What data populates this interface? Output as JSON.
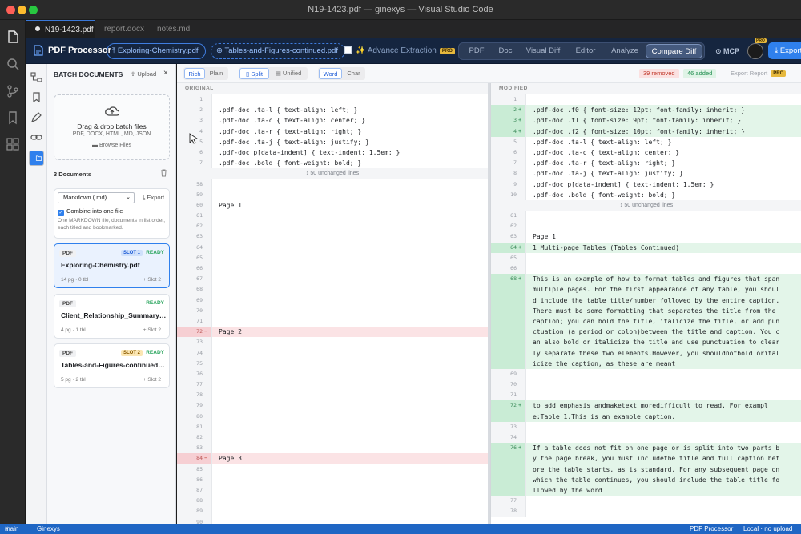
{
  "window": {
    "title": "N19-1423.pdf — ginexys — Visual Studio Code"
  },
  "tabs": [
    {
      "label": "N19-1423.pdf",
      "active": true
    },
    {
      "label": "report.docx",
      "active": false
    },
    {
      "label": "notes.md",
      "active": false
    }
  ],
  "toolbar": {
    "brand": "PDF Processor",
    "file_a": "Exploring-Chemistry.pdf",
    "file_b": "Tables-and-Figures-continued.pdf",
    "advance_extraction": "Advance Extraction",
    "pro_badge": "PRO",
    "modes": [
      "PDF",
      "Doc",
      "Visual Diff",
      "Editor",
      "Analyze",
      "Compare Diff"
    ],
    "active_mode": "Compare Diff",
    "mcp": "MCP",
    "avatar_badge": "PRO",
    "export": "Export"
  },
  "sidebar": {
    "header": "BATCH DOCUMENTS",
    "upload": "Upload",
    "close": "×",
    "drop_title": "Drag & drop batch files",
    "drop_formats": "PDF, DOCX, HTML, MD, JSON",
    "browse": "Browse Files",
    "doc_count": "3 Documents",
    "export_format": "Markdown (.md)",
    "export_label": "Export",
    "combine_label": "Combine into one file",
    "combine_checked": true,
    "combine_note": "One MARKDOWN file, documents in list order, each titled and bookmarked.",
    "documents": [
      {
        "type": "PDF",
        "name": "Exploring-Chemistry.pdf",
        "slot": "SLOT 1",
        "status": "READY",
        "meta": "14 pg · 0 tbl",
        "slot_action": "+ Slot 2",
        "active": true
      },
      {
        "type": "PDF",
        "name": "Client_Relationship_Summary_Form_CRS.pdf",
        "slot": "",
        "status": "READY",
        "meta": "4 pg · 1 tbl",
        "slot_action": "+ Slot 2",
        "active": false
      },
      {
        "type": "PDF",
        "name": "Tables-and-Figures-continued.pdf",
        "slot": "SLOT 2",
        "status": "READY",
        "meta": "5 pg · 2 tbl",
        "slot_action": "+ Slot 2",
        "active": false
      }
    ]
  },
  "diff_toolbar": {
    "view": [
      "Rich",
      "Plain"
    ],
    "view_active": "Rich",
    "layout": [
      "Split",
      "Unified"
    ],
    "layout_active": "Split",
    "granularity": [
      "Word",
      "Char"
    ],
    "granularity_active": "Word",
    "removed": "39 removed",
    "added": "46 added",
    "export_report": "Export Report",
    "pro_badge": "PRO"
  },
  "original": {
    "header": "ORIGINAL",
    "lines": [
      {
        "n": "1",
        "t": ""
      },
      {
        "n": "2",
        "t": ".pdf-doc .ta-l  { text-align: left; }"
      },
      {
        "n": "3",
        "t": ".pdf-doc .ta-c  { text-align: center; }"
      },
      {
        "n": "4",
        "t": ".pdf-doc .ta-r  { text-align: right; }"
      },
      {
        "n": "5",
        "t": ".pdf-doc .ta-j  { text-align: justify; }"
      },
      {
        "n": "6",
        "t": ".pdf-doc p[data-indent] { text-indent: 1.5em; }"
      },
      {
        "n": "7",
        "t": ".pdf-doc .bold  { font-weight: bold; }"
      },
      {
        "fold": "↕ 50 unchanged lines"
      },
      {
        "n": "58",
        "t": ""
      },
      {
        "n": "59",
        "t": ""
      },
      {
        "n": "60",
        "t": "Page 1"
      },
      {
        "n": "61",
        "t": ""
      },
      {
        "n": "62",
        "t": ""
      },
      {
        "n": "63",
        "t": ""
      },
      {
        "n": "64",
        "t": ""
      },
      {
        "n": "65",
        "t": ""
      },
      {
        "n": "66",
        "t": ""
      },
      {
        "n": "67",
        "t": ""
      },
      {
        "n": "68",
        "t": ""
      },
      {
        "n": "69",
        "t": ""
      },
      {
        "n": "70",
        "t": ""
      },
      {
        "n": "71",
        "t": ""
      },
      {
        "n": "72",
        "t": "Page 2",
        "d": "del"
      },
      {
        "n": "73",
        "t": ""
      },
      {
        "n": "74",
        "t": ""
      },
      {
        "n": "75",
        "t": ""
      },
      {
        "n": "76",
        "t": ""
      },
      {
        "n": "77",
        "t": ""
      },
      {
        "n": "78",
        "t": ""
      },
      {
        "n": "79",
        "t": ""
      },
      {
        "n": "80",
        "t": ""
      },
      {
        "n": "81",
        "t": ""
      },
      {
        "n": "82",
        "t": ""
      },
      {
        "n": "83",
        "t": ""
      },
      {
        "n": "84",
        "t": "Page 3",
        "d": "del"
      },
      {
        "n": "85",
        "t": ""
      },
      {
        "n": "86",
        "t": ""
      },
      {
        "n": "87",
        "t": ""
      },
      {
        "n": "88",
        "t": ""
      },
      {
        "n": "89",
        "t": ""
      },
      {
        "n": "90",
        "t": ""
      },
      {
        "n": "91",
        "t": ""
      },
      {
        "n": "92",
        "t": ""
      },
      {
        "n": "93",
        "t": ""
      }
    ]
  },
  "modified": {
    "header": "MODIFIED",
    "lines": [
      {
        "n": "1",
        "t": ""
      },
      {
        "n": "2",
        "t": ".pdf-doc .f0 { font-size: 12pt; font-family: inherit; }",
        "d": "add"
      },
      {
        "n": "3",
        "t": ".pdf-doc .f1 { font-size: 9pt; font-family: inherit; }",
        "d": "add"
      },
      {
        "n": "4",
        "t": ".pdf-doc .f2 { font-size: 10pt; font-family: inherit; }",
        "d": "add"
      },
      {
        "n": "5",
        "t": ".pdf-doc .ta-l  { text-align: left; }"
      },
      {
        "n": "6",
        "t": ".pdf-doc .ta-c  { text-align: center; }"
      },
      {
        "n": "7",
        "t": ".pdf-doc .ta-r  { text-align: right; }"
      },
      {
        "n": "8",
        "t": ".pdf-doc .ta-j  { text-align: justify; }"
      },
      {
        "n": "9",
        "t": ".pdf-doc p[data-indent] { text-indent: 1.5em; }"
      },
      {
        "n": "10",
        "t": ".pdf-doc .bold  { font-weight: bold; }"
      },
      {
        "fold": "↕ 50 unchanged lines"
      },
      {
        "n": "61",
        "t": ""
      },
      {
        "n": "62",
        "t": ""
      },
      {
        "n": "63",
        "t": "Page 1"
      },
      {
        "n": "64",
        "t": "1 Multi-page Tables (Tables Continued)",
        "d": "add"
      },
      {
        "n": "65",
        "t": ""
      },
      {
        "n": "66",
        "t": ""
      },
      {
        "n": "68",
        "t": "This is an example of how to format tables and figures that span",
        "d": "add"
      },
      {
        "n": "",
        "t": "multiple pages. For the first appearance of any table, you shoul",
        "d": "add"
      },
      {
        "n": "",
        "t": "d include the table title/number followed by the entire caption.",
        "d": "add"
      },
      {
        "n": "",
        "t": "There must be some formatting that separates the title from the",
        "d": "add"
      },
      {
        "n": "",
        "t": "caption; you can bold the title, italicize the title, or add pun",
        "d": "add"
      },
      {
        "n": "",
        "t": "ctuation (a period or colon)between the title and caption. You c",
        "d": "add"
      },
      {
        "n": "",
        "t": "an also bold or italicize the title and use punctuation to clear",
        "d": "add"
      },
      {
        "n": "",
        "t": "ly separate these two elements.However, you shouldnotbold orital",
        "d": "add"
      },
      {
        "n": "",
        "t": "icize the caption, as these are meant",
        "d": "add"
      },
      {
        "n": "69",
        "t": ""
      },
      {
        "n": "70",
        "t": ""
      },
      {
        "n": "71",
        "t": ""
      },
      {
        "n": "72",
        "t": "to add emphasis andmaketext moredifficult to read.  For exampl",
        "d": "add"
      },
      {
        "n": "",
        "t": "e:Table 1.This is an example caption.",
        "d": "add"
      },
      {
        "n": "73",
        "t": ""
      },
      {
        "n": "74",
        "t": ""
      },
      {
        "n": "76",
        "t": "If a table does not fit on one page or is split into two parts b",
        "d": "add"
      },
      {
        "n": "",
        "t": "y the page break, you must includethe title and full caption bef",
        "d": "add"
      },
      {
        "n": "",
        "t": "ore the table starts, as is standard. For any subsequent page on",
        "d": "add"
      },
      {
        "n": "",
        "t": "which the table continues, you should include the table title fo",
        "d": "add"
      },
      {
        "n": "",
        "t": "llowed by the word",
        "d": "add"
      },
      {
        "n": "77",
        "t": ""
      },
      {
        "n": "78",
        "t": ""
      }
    ]
  },
  "status": {
    "branch": "main",
    "workspace": "Ginexys",
    "app": "PDF Processor",
    "upload_state": "Local · no upload"
  },
  "colors": {
    "accent": "#2f80ed",
    "removed": "#fbe3e5",
    "added": "#e3f5e9",
    "toolbar": "#15253f"
  }
}
